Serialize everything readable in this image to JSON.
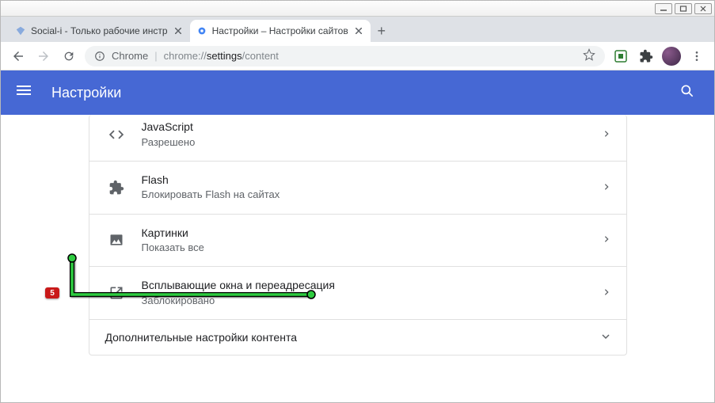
{
  "window": {
    "tabs": [
      {
        "title": "Social-i - Только рабочие инстр",
        "favicon_color": "#6699cc"
      },
      {
        "title": "Настройки – Настройки сайтов",
        "favicon_color": "#4285f4"
      }
    ]
  },
  "addressBar": {
    "browserLabel": "Chrome",
    "urlPrefix": "chrome://",
    "urlBold": "settings",
    "urlSuffix": "/content"
  },
  "header": {
    "title": "Настройки"
  },
  "settings": [
    {
      "icon": "code",
      "title": "JavaScript",
      "sub": "Разрешено"
    },
    {
      "icon": "puzzle",
      "title": "Flash",
      "sub": "Блокировать Flash на сайтах"
    },
    {
      "icon": "image",
      "title": "Картинки",
      "sub": "Показать все"
    },
    {
      "icon": "launch",
      "title": "Всплывающие окна и переадресация",
      "sub": "Заблокировано"
    }
  ],
  "expand": {
    "label": "Дополнительные настройки контента"
  },
  "annotation": {
    "number": "5"
  }
}
